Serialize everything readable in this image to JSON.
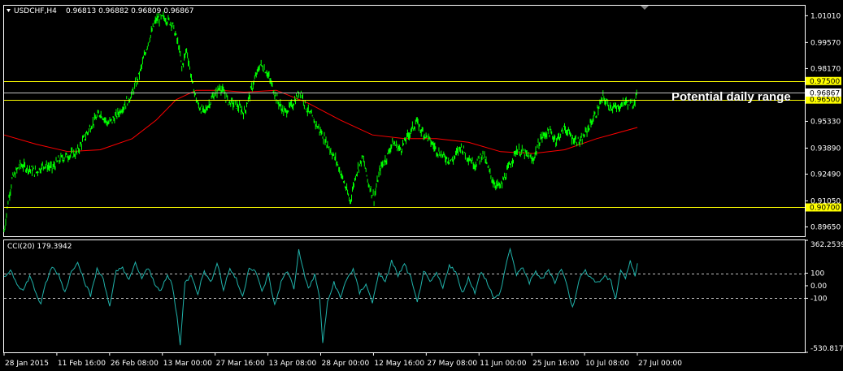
{
  "header": {
    "symbol": "USDCHF,H4",
    "ohlc": "0.96813 0.96882 0.96809 0.96867",
    "indicator_label": "CCI(20) 179.3942"
  },
  "colors": {
    "background": "#000000",
    "frame": "#ffffff",
    "price": "#00ff00",
    "ma": "#ff0000",
    "cci": "#20b2aa",
    "level_line": "#ffff00",
    "level_label_bg": "#ffff00",
    "current_price_line": "#c0c0c0",
    "current_price_label_bg": "#ffffff"
  },
  "chart_data": [
    {
      "type": "line",
      "title": "USDCHF,H4",
      "annotation": "Potential daily range",
      "yticks": [
        "1.01010",
        "0.99570",
        "0.98170",
        "0.95330",
        "0.93890",
        "0.92490",
        "0.91050",
        "0.89650"
      ],
      "ylim": [
        0.8915,
        1.0155
      ],
      "xticks": [
        "28 Jan 2015",
        "11 Feb 16:00",
        "26 Feb 08:00",
        "13 Mar 00:00",
        "27 Mar 16:00",
        "13 Apr 08:00",
        "28 Apr 00:00",
        "12 May 16:00",
        "27 May 08:00",
        "11 Jun 00:00",
        "25 Jun 16:00",
        "10 Jul 08:00",
        "27 Jul 00:00"
      ],
      "levels": [
        {
          "label": "0.97500",
          "value": 0.975
        },
        {
          "label": "0.96500",
          "value": 0.965
        },
        {
          "label": "0.90700",
          "value": 0.907
        }
      ],
      "current_price": {
        "label": "0.96867",
        "value": 0.96867
      },
      "series": [
        {
          "role": "price",
          "values": [
            [
              0,
              0.894
            ],
            [
              5,
              0.91
            ],
            [
              10,
              0.922
            ],
            [
              20,
              0.93
            ],
            [
              30,
              0.928
            ],
            [
              40,
              0.926
            ],
            [
              50,
              0.93
            ],
            [
              60,
              0.928
            ],
            [
              70,
              0.933
            ],
            [
              80,
              0.935
            ],
            [
              90,
              0.936
            ],
            [
              100,
              0.944
            ],
            [
              110,
              0.952
            ],
            [
              120,
              0.958
            ],
            [
              130,
              0.952
            ],
            [
              140,
              0.956
            ],
            [
              150,
              0.962
            ],
            [
              160,
              0.968
            ],
            [
              170,
              0.98
            ],
            [
              180,
              0.996
            ],
            [
              190,
              1.008
            ],
            [
              200,
              1.009
            ],
            [
              210,
              1.006
            ],
            [
              218,
              0.994
            ],
            [
              222,
              0.982
            ],
            [
              228,
              0.992
            ],
            [
              235,
              0.974
            ],
            [
              242,
              0.962
            ],
            [
              250,
              0.958
            ],
            [
              260,
              0.966
            ],
            [
              270,
              0.972
            ],
            [
              280,
              0.964
            ],
            [
              290,
              0.962
            ],
            [
              300,
              0.958
            ],
            [
              310,
              0.972
            ],
            [
              320,
              0.984
            ],
            [
              328,
              0.98
            ],
            [
              335,
              0.972
            ],
            [
              342,
              0.964
            ],
            [
              350,
              0.958
            ],
            [
              360,
              0.962
            ],
            [
              370,
              0.97
            ],
            [
              378,
              0.96
            ],
            [
              385,
              0.955
            ],
            [
              395,
              0.948
            ],
            [
              405,
              0.94
            ],
            [
              415,
              0.932
            ],
            [
              425,
              0.92
            ],
            [
              432,
              0.91
            ],
            [
              440,
              0.926
            ],
            [
              448,
              0.934
            ],
            [
              455,
              0.92
            ],
            [
              462,
              0.912
            ],
            [
              470,
              0.928
            ],
            [
              478,
              0.934
            ],
            [
              485,
              0.942
            ],
            [
              495,
              0.938
            ],
            [
              505,
              0.946
            ],
            [
              515,
              0.953
            ],
            [
              522,
              0.948
            ],
            [
              530,
              0.944
            ],
            [
              540,
              0.938
            ],
            [
              550,
              0.934
            ],
            [
              560,
              0.932
            ],
            [
              570,
              0.94
            ],
            [
              578,
              0.935
            ],
            [
              588,
              0.93
            ],
            [
              598,
              0.936
            ],
            [
              606,
              0.926
            ],
            [
              612,
              0.92
            ],
            [
              620,
              0.918
            ],
            [
              630,
              0.928
            ],
            [
              640,
              0.938
            ],
            [
              650,
              0.936
            ],
            [
              660,
              0.932
            ],
            [
              670,
              0.944
            ],
            [
              680,
              0.948
            ],
            [
              690,
              0.943
            ],
            [
              700,
              0.95
            ],
            [
              710,
              0.944
            ],
            [
              720,
              0.942
            ],
            [
              730,
              0.95
            ],
            [
              740,
              0.958
            ],
            [
              748,
              0.966
            ],
            [
              755,
              0.962
            ],
            [
              765,
              0.96
            ],
            [
              775,
              0.964
            ],
            [
              785,
              0.962
            ],
            [
              791,
              0.969
            ]
          ]
        },
        {
          "role": "moving-average",
          "values": [
            [
              0,
              0.946
            ],
            [
              40,
              0.941
            ],
            [
              80,
              0.937
            ],
            [
              120,
              0.938
            ],
            [
              160,
              0.944
            ],
            [
              190,
              0.954
            ],
            [
              215,
              0.965
            ],
            [
              240,
              0.97
            ],
            [
              270,
              0.97
            ],
            [
              300,
              0.969
            ],
            [
              340,
              0.97
            ],
            [
              380,
              0.963
            ],
            [
              420,
              0.954
            ],
            [
              460,
              0.946
            ],
            [
              500,
              0.944
            ],
            [
              540,
              0.944
            ],
            [
              580,
              0.942
            ],
            [
              620,
              0.937
            ],
            [
              660,
              0.936
            ],
            [
              700,
              0.938
            ],
            [
              740,
              0.944
            ],
            [
              791,
              0.95
            ]
          ]
        }
      ]
    },
    {
      "type": "line",
      "title": "CCI(20) 179.3942",
      "yticks": [
        "362.2539",
        "100",
        "0.00",
        "-100",
        "-530.8174"
      ],
      "ylim": [
        -530.8174,
        362.2539
      ],
      "levels": [
        100,
        -100
      ],
      "series": [
        {
          "role": "cci",
          "values": [
            [
              0,
              60
            ],
            [
              8,
              130
            ],
            [
              16,
              20
            ],
            [
              24,
              -40
            ],
            [
              32,
              80
            ],
            [
              40,
              -60
            ],
            [
              46,
              -150
            ],
            [
              52,
              20
            ],
            [
              60,
              150
            ],
            [
              68,
              90
            ],
            [
              76,
              -50
            ],
            [
              84,
              110
            ],
            [
              92,
              200
            ],
            [
              100,
              40
            ],
            [
              108,
              -80
            ],
            [
              116,
              130
            ],
            [
              124,
              60
            ],
            [
              132,
              -170
            ],
            [
              140,
              110
            ],
            [
              148,
              150
            ],
            [
              156,
              40
            ],
            [
              164,
              180
            ],
            [
              172,
              60
            ],
            [
              180,
              140
            ],
            [
              188,
              20
            ],
            [
              196,
              -40
            ],
            [
              204,
              80
            ],
            [
              210,
              10
            ],
            [
              216,
              -250
            ],
            [
              220,
              -460
            ],
            [
              226,
              20
            ],
            [
              234,
              90
            ],
            [
              242,
              -60
            ],
            [
              250,
              120
            ],
            [
              258,
              20
            ],
            [
              266,
              190
            ],
            [
              274,
              -30
            ],
            [
              282,
              140
            ],
            [
              290,
              50
            ],
            [
              298,
              -90
            ],
            [
              306,
              150
            ],
            [
              314,
              120
            ],
            [
              322,
              -50
            ],
            [
              330,
              90
            ],
            [
              338,
              -160
            ],
            [
              346,
              30
            ],
            [
              354,
              120
            ],
            [
              362,
              -20
            ],
            [
              368,
              280
            ],
            [
              374,
              120
            ],
            [
              380,
              -30
            ],
            [
              388,
              90
            ],
            [
              394,
              -100
            ],
            [
              398,
              -450
            ],
            [
              404,
              -140
            ],
            [
              412,
              30
            ],
            [
              420,
              -100
            ],
            [
              428,
              60
            ],
            [
              436,
              130
            ],
            [
              444,
              -60
            ],
            [
              452,
              20
            ],
            [
              460,
              -140
            ],
            [
              468,
              110
            ],
            [
              476,
              20
            ],
            [
              484,
              200
            ],
            [
              492,
              80
            ],
            [
              500,
              170
            ],
            [
              508,
              60
            ],
            [
              516,
              -140
            ],
            [
              524,
              120
            ],
            [
              532,
              20
            ],
            [
              540,
              100
            ],
            [
              548,
              -20
            ],
            [
              556,
              170
            ],
            [
              564,
              110
            ],
            [
              572,
              -60
            ],
            [
              580,
              60
            ],
            [
              588,
              -50
            ],
            [
              596,
              120
            ],
            [
              604,
              20
            ],
            [
              612,
              -110
            ],
            [
              620,
              -50
            ],
            [
              626,
              140
            ],
            [
              632,
              300
            ],
            [
              640,
              80
            ],
            [
              648,
              150
            ],
            [
              656,
              20
            ],
            [
              664,
              110
            ],
            [
              672,
              50
            ],
            [
              680,
              130
            ],
            [
              688,
              30
            ],
            [
              696,
              140
            ],
            [
              704,
              -20
            ],
            [
              710,
              -180
            ],
            [
              718,
              50
            ],
            [
              726,
              120
            ],
            [
              734,
              60
            ],
            [
              742,
              20
            ],
            [
              750,
              80
            ],
            [
              758,
              30
            ],
            [
              764,
              -100
            ],
            [
              770,
              130
            ],
            [
              776,
              60
            ],
            [
              782,
              190
            ],
            [
              788,
              80
            ],
            [
              791,
              179.4
            ]
          ]
        }
      ]
    }
  ]
}
